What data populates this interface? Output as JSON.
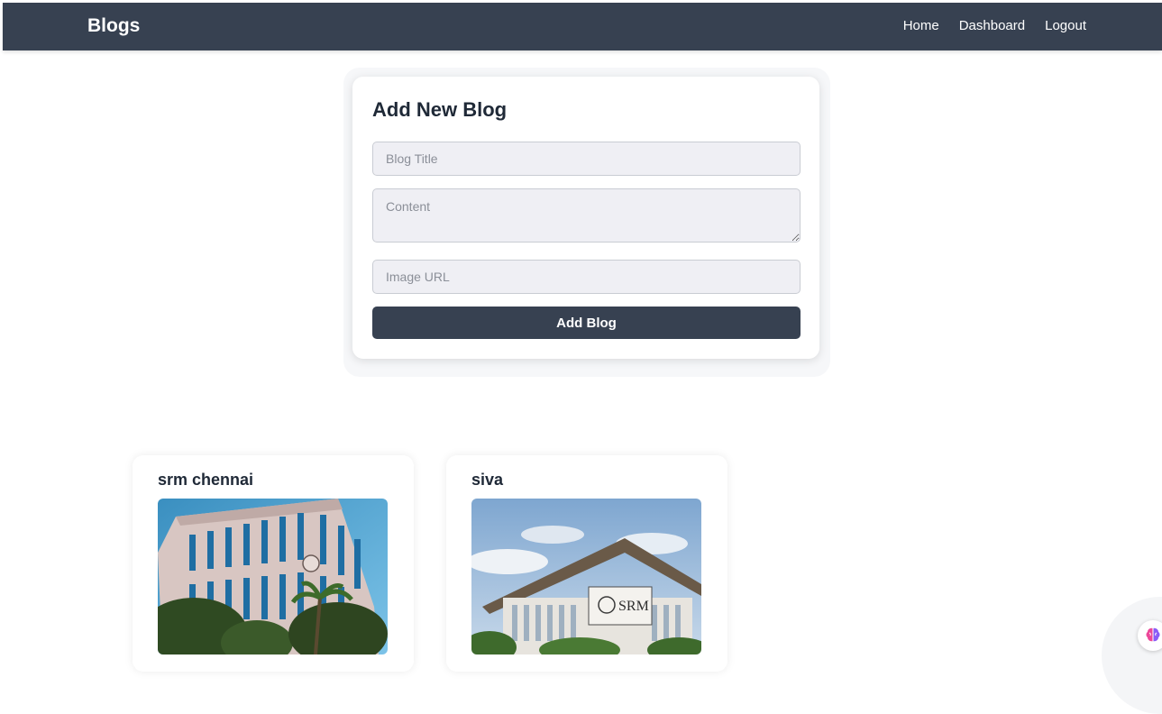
{
  "nav": {
    "brand": "Blogs",
    "links": [
      "Home",
      "Dashboard",
      "Logout"
    ]
  },
  "form": {
    "title": "Add New Blog",
    "title_placeholder": "Blog Title",
    "content_placeholder": "Content",
    "image_placeholder": "Image URL",
    "submit_label": "Add Blog"
  },
  "blogs": [
    {
      "title": "srm chennai",
      "image_icon": "building-photo"
    },
    {
      "title": "siva",
      "image_icon": "srm-building-photo"
    }
  ],
  "assistant": {
    "icon": "brain-icon"
  },
  "colors": {
    "nav_bg": "#374151",
    "button_bg": "#374151",
    "input_bg": "#efeff4"
  }
}
